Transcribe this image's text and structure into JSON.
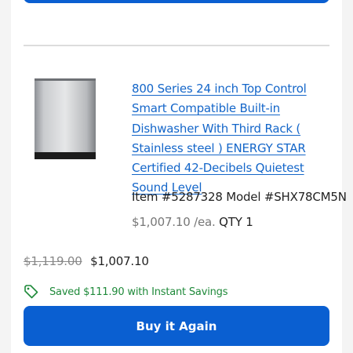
{
  "product": {
    "title": "800 Series 24 inch Top Control Smart Compatible Built-in Dishwasher With Third Rack ( Stainless steel ) ENERGY STAR Certified 42-Decibels Quietest Sound Level",
    "item_line": "Item #5287328 Model #SHX78CM5N",
    "unit_price": "$1,007.10 /ea.",
    "qty": "QTY 1",
    "image_icon": "dishwasher-image"
  },
  "pricing": {
    "original_price": "$1,119.00",
    "sale_price": "$1,007.10"
  },
  "savings": {
    "text": "Saved $111.90 with Instant Savings",
    "icon": "tag-icon",
    "color": "#1f8a3a"
  },
  "actions": {
    "buy_again_label": "Buy it Again"
  },
  "colors": {
    "accent": "#0a5fd1",
    "link": "#1466c9"
  }
}
